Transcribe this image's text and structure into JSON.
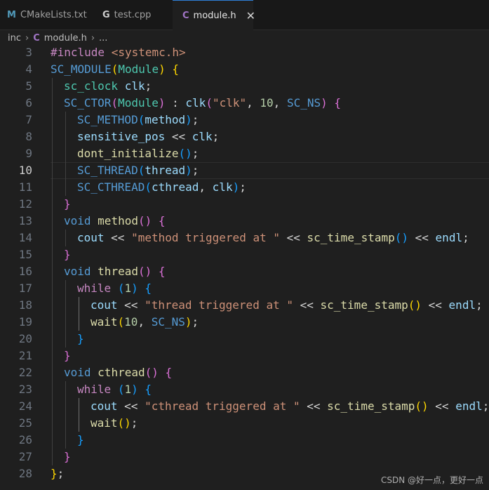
{
  "tabs": [
    {
      "label": "CMakeLists.txt",
      "icon": "M",
      "icon_color": "#519aba"
    },
    {
      "label": "test.cpp",
      "icon": "G",
      "icon_color": "#cccccc"
    },
    {
      "label": "module.h",
      "icon": "C",
      "icon_color": "#a074c4",
      "close": "✕"
    }
  ],
  "breadcrumb": {
    "folder": "inc",
    "sep1": "›",
    "file_icon": "C",
    "file": "module.h",
    "sep2": "›",
    "rest": "..."
  },
  "editor": {
    "current_line": 10,
    "lines": [
      {
        "n": 3,
        "indent": 0,
        "toks": [
          [
            "#include ",
            "pp"
          ],
          [
            "<systemc.h>",
            "str"
          ]
        ]
      },
      {
        "n": 4,
        "indent": 0,
        "toks": [
          [
            "SC_MODULE",
            "mac"
          ],
          [
            "(",
            "b1"
          ],
          [
            "Module",
            "typ"
          ],
          [
            ")",
            "b1"
          ],
          [
            " ",
            "pl"
          ],
          [
            "{",
            "b1"
          ]
        ]
      },
      {
        "n": 5,
        "indent": 1,
        "toks": [
          [
            "sc_clock",
            "typ"
          ],
          [
            " ",
            "pl"
          ],
          [
            "clk",
            "var"
          ],
          [
            ";",
            "pl"
          ]
        ]
      },
      {
        "n": 6,
        "indent": 1,
        "toks": [
          [
            "SC_CTOR",
            "mac"
          ],
          [
            "(",
            "b2"
          ],
          [
            "Module",
            "typ"
          ],
          [
            ")",
            "b2"
          ],
          [
            " : ",
            "pl"
          ],
          [
            "clk",
            "var"
          ],
          [
            "(",
            "b2"
          ],
          [
            "\"clk\"",
            "str"
          ],
          [
            ", ",
            "pl"
          ],
          [
            "10",
            "num"
          ],
          [
            ", ",
            "pl"
          ],
          [
            "SC_NS",
            "mac"
          ],
          [
            ")",
            "b2"
          ],
          [
            " ",
            "pl"
          ],
          [
            "{",
            "b2"
          ]
        ]
      },
      {
        "n": 7,
        "indent": 2,
        "toks": [
          [
            "SC_METHOD",
            "mac"
          ],
          [
            "(",
            "b3"
          ],
          [
            "method",
            "var"
          ],
          [
            ")",
            "b3"
          ],
          [
            ";",
            "pl"
          ]
        ]
      },
      {
        "n": 8,
        "indent": 2,
        "toks": [
          [
            "sensitive_pos",
            "var"
          ],
          [
            " << ",
            "pl"
          ],
          [
            "clk",
            "var"
          ],
          [
            ";",
            "pl"
          ]
        ]
      },
      {
        "n": 9,
        "indent": 2,
        "toks": [
          [
            "dont_initialize",
            "fn"
          ],
          [
            "()",
            "b3"
          ],
          [
            ";",
            "pl"
          ]
        ]
      },
      {
        "n": 10,
        "indent": 2,
        "toks": [
          [
            "SC_THREAD",
            "mac"
          ],
          [
            "(",
            "b3"
          ],
          [
            "thread",
            "var"
          ],
          [
            ")",
            "b3"
          ],
          [
            ";",
            "pl"
          ]
        ]
      },
      {
        "n": 11,
        "indent": 2,
        "toks": [
          [
            "SC_CTHREAD",
            "mac"
          ],
          [
            "(",
            "b3"
          ],
          [
            "cthread",
            "var"
          ],
          [
            ", ",
            "pl"
          ],
          [
            "clk",
            "var"
          ],
          [
            ")",
            "b3"
          ],
          [
            ";",
            "pl"
          ]
        ]
      },
      {
        "n": 12,
        "indent": 1,
        "toks": [
          [
            "}",
            "b2"
          ]
        ]
      },
      {
        "n": 13,
        "indent": 1,
        "toks": [
          [
            "void",
            "kw"
          ],
          [
            " ",
            "pl"
          ],
          [
            "method",
            "fn"
          ],
          [
            "()",
            "b2"
          ],
          [
            " ",
            "pl"
          ],
          [
            "{",
            "b2"
          ]
        ]
      },
      {
        "n": 14,
        "indent": 2,
        "toks": [
          [
            "cout",
            "var"
          ],
          [
            " << ",
            "pl"
          ],
          [
            "\"method triggered at \"",
            "str"
          ],
          [
            " << ",
            "pl"
          ],
          [
            "sc_time_stamp",
            "fn"
          ],
          [
            "()",
            "b3"
          ],
          [
            " << ",
            "pl"
          ],
          [
            "endl",
            "var"
          ],
          [
            ";",
            "pl"
          ]
        ]
      },
      {
        "n": 15,
        "indent": 1,
        "toks": [
          [
            "}",
            "b2"
          ]
        ]
      },
      {
        "n": 16,
        "indent": 1,
        "toks": [
          [
            "void",
            "kw"
          ],
          [
            " ",
            "pl"
          ],
          [
            "thread",
            "fn"
          ],
          [
            "()",
            "b2"
          ],
          [
            " ",
            "pl"
          ],
          [
            "{",
            "b2"
          ]
        ]
      },
      {
        "n": 17,
        "indent": 2,
        "toks": [
          [
            "while",
            "ctl"
          ],
          [
            " ",
            "pl"
          ],
          [
            "(",
            "b3"
          ],
          [
            "1",
            "num"
          ],
          [
            ")",
            "b3"
          ],
          [
            " ",
            "pl"
          ],
          [
            "{",
            "b3"
          ]
        ]
      },
      {
        "n": 18,
        "indent": 3,
        "toks": [
          [
            "cout",
            "var"
          ],
          [
            " << ",
            "pl"
          ],
          [
            "\"thread triggered at \"",
            "str"
          ],
          [
            " << ",
            "pl"
          ],
          [
            "sc_time_stamp",
            "fn"
          ],
          [
            "()",
            "b1"
          ],
          [
            " << ",
            "pl"
          ],
          [
            "endl",
            "var"
          ],
          [
            ";",
            "pl"
          ]
        ]
      },
      {
        "n": 19,
        "indent": 3,
        "toks": [
          [
            "wait",
            "fn"
          ],
          [
            "(",
            "b1"
          ],
          [
            "10",
            "num"
          ],
          [
            ", ",
            "pl"
          ],
          [
            "SC_NS",
            "mac"
          ],
          [
            ")",
            "b1"
          ],
          [
            ";",
            "pl"
          ]
        ]
      },
      {
        "n": 20,
        "indent": 2,
        "toks": [
          [
            "}",
            "b3"
          ]
        ]
      },
      {
        "n": 21,
        "indent": 1,
        "toks": [
          [
            "}",
            "b2"
          ]
        ]
      },
      {
        "n": 22,
        "indent": 1,
        "toks": [
          [
            "void",
            "kw"
          ],
          [
            " ",
            "pl"
          ],
          [
            "cthread",
            "fn"
          ],
          [
            "()",
            "b2"
          ],
          [
            " ",
            "pl"
          ],
          [
            "{",
            "b2"
          ]
        ]
      },
      {
        "n": 23,
        "indent": 2,
        "toks": [
          [
            "while",
            "ctl"
          ],
          [
            " ",
            "pl"
          ],
          [
            "(",
            "b3"
          ],
          [
            "1",
            "num"
          ],
          [
            ")",
            "b3"
          ],
          [
            " ",
            "pl"
          ],
          [
            "{",
            "b3"
          ]
        ]
      },
      {
        "n": 24,
        "indent": 3,
        "toks": [
          [
            "cout",
            "var"
          ],
          [
            " << ",
            "pl"
          ],
          [
            "\"cthread triggered at \"",
            "str"
          ],
          [
            " << ",
            "pl"
          ],
          [
            "sc_time_stamp",
            "fn"
          ],
          [
            "()",
            "b1"
          ],
          [
            " << ",
            "pl"
          ],
          [
            "endl",
            "var"
          ],
          [
            ";",
            "pl"
          ]
        ]
      },
      {
        "n": 25,
        "indent": 3,
        "toks": [
          [
            "wait",
            "fn"
          ],
          [
            "()",
            "b1"
          ],
          [
            ";",
            "pl"
          ]
        ]
      },
      {
        "n": 26,
        "indent": 2,
        "toks": [
          [
            "}",
            "b3"
          ]
        ]
      },
      {
        "n": 27,
        "indent": 1,
        "toks": [
          [
            "}",
            "b2"
          ]
        ]
      },
      {
        "n": 28,
        "indent": 0,
        "toks": [
          [
            "}",
            "b1"
          ],
          [
            ";",
            "pl"
          ]
        ]
      }
    ]
  },
  "watermark": "CSDN @好一点，更好一点"
}
